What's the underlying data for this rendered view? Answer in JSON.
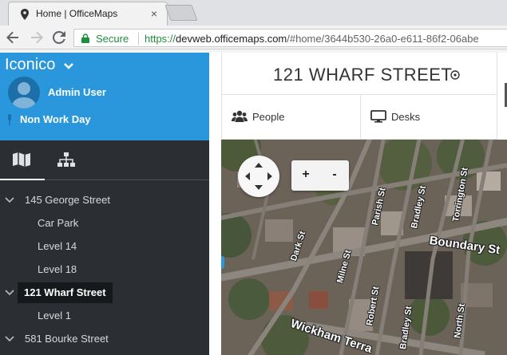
{
  "browser": {
    "tab_title": "Home | OfficeMaps",
    "tab_close": "×",
    "secure_label": "Secure",
    "url_scheme": "https://",
    "url_host": "devweb.officemaps.com",
    "url_path": "/#home/3644b530-26a0-e611-86f2-06abe"
  },
  "sidebar": {
    "org_name": "Iconico",
    "username": "Admin User",
    "status": "Non Work Day",
    "tree": [
      {
        "label": "145 George Street",
        "level": 0,
        "expanded": true
      },
      {
        "label": "Car Park",
        "level": 1
      },
      {
        "label": "Level 14",
        "level": 1
      },
      {
        "label": "Level 18",
        "level": 1
      },
      {
        "label": "121 Wharf Street",
        "level": 0,
        "expanded": true,
        "selected": true
      },
      {
        "label": "Level 1",
        "level": 1
      },
      {
        "label": "581 Bourke Street",
        "level": 0,
        "expanded": true
      }
    ]
  },
  "main": {
    "building_title": "121 WHARF STREET",
    "tabs": [
      {
        "label": "People",
        "icon": "people-icon"
      },
      {
        "label": "Desks",
        "icon": "monitor-icon"
      }
    ],
    "zoom_in": "+",
    "zoom_out": "-"
  },
  "map": {
    "streets": [
      "Boundary St",
      "Wickham Terra",
      "Dark St",
      "Milne St",
      "Parish St",
      "Bradley St",
      "Torrington St",
      "Robert St",
      "North St",
      "Bradley St"
    ]
  }
}
